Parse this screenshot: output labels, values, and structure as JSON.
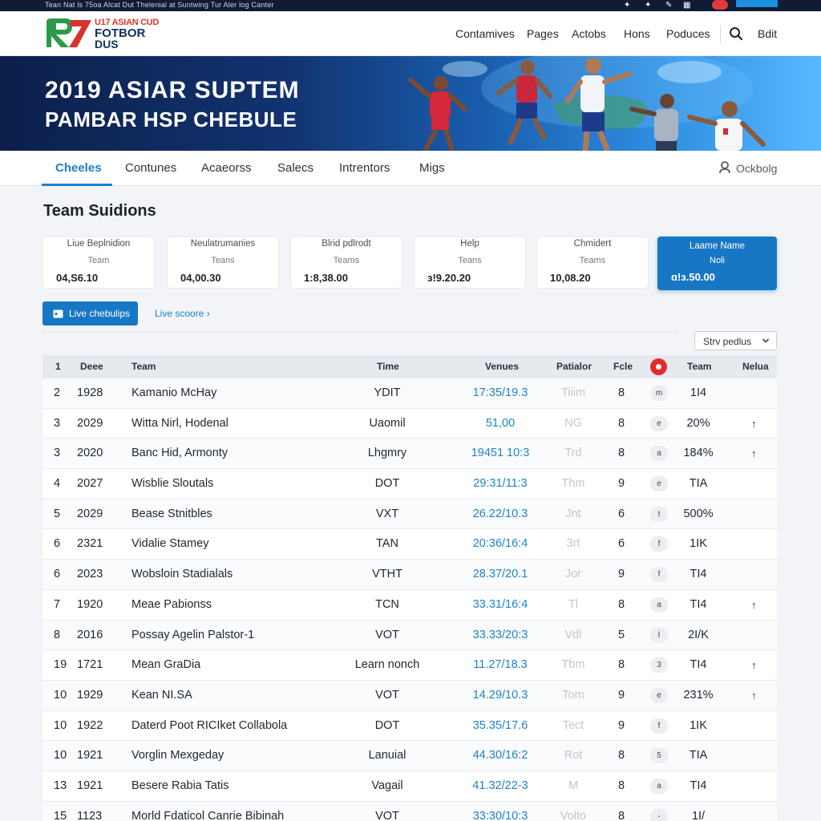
{
  "topstrip": {
    "text": "Tean Nat ls 75oa Alcat Dut Thelenial at Suntwing Tur Aler log Canter"
  },
  "header": {
    "logo": {
      "line1": "U17 ASIAN CUD",
      "line2": "FOTBOR",
      "line3": "DUS"
    },
    "nav": [
      "Contamives",
      "Pages",
      "Actobs",
      "Hons",
      "Poduces"
    ],
    "edit_label": "Bdit"
  },
  "banner": {
    "title": "2019 ASIAR SUPTEM",
    "subtitle": "PAMBAR HSP CHEBULE"
  },
  "tabs": [
    "Cheeles",
    "Contunes",
    "Acaeorss",
    "Salecs",
    "Intrentors",
    "Migs"
  ],
  "user_label": "Ockbolg",
  "section_title": "Team Suidions",
  "cards": [
    {
      "title": "Liue Beplnidion",
      "sub": "Team",
      "value": "04,S6.10"
    },
    {
      "title": "Neulatrumanies",
      "sub": "Teans",
      "value": "04,00.30"
    },
    {
      "title": "Blrid pdlrodt",
      "sub": "Teams",
      "value": "1:8,38.00"
    },
    {
      "title": "Help",
      "sub": "Teans",
      "value": "ɜ!9.20.20"
    },
    {
      "title": "Chmidert",
      "sub": "Teams",
      "value": "10,08.20"
    },
    {
      "title": "Laame Name",
      "sub": "Noli",
      "value": "ɑ!ɜ.50.00"
    }
  ],
  "live_button": "Live chebulips",
  "live_score": "Live scoore ›",
  "sort_select": "Strv pedlus",
  "table": {
    "headers": [
      "1",
      "Deee",
      "Team",
      "Time",
      "Venues",
      "Patialor",
      "Fcle",
      "Team",
      "Nelua"
    ],
    "rows": [
      {
        "n": "2",
        "year": "1928",
        "team": "Kamanio McHay",
        "time": "YDIT",
        "venue": "17:35/19.3",
        "pat": "Tiiim",
        "f": "8",
        "pill": "m",
        "t2": "1I4",
        "arrow": ""
      },
      {
        "n": "3",
        "year": "2029",
        "team": "Witta Nirl, Hodenal",
        "time": "Uaomil",
        "venue": "51,00",
        "pat": "NG",
        "f": "8",
        "pill": "e",
        "t2": "20%",
        "arrow": "↑"
      },
      {
        "n": "3",
        "year": "2020",
        "team": "Banc Hid, Armonty",
        "time": "Lhgmry",
        "venue": "19451 10:3",
        "pat": "Trd",
        "f": "8",
        "pill": "a",
        "t2": "184%",
        "arrow": "↑"
      },
      {
        "n": "4",
        "year": "2027",
        "team": "Wisblie Sloutals",
        "time": "DOT",
        "venue": "29:31/11:3",
        "pat": "Thm",
        "f": "9",
        "pill": "e",
        "t2": "TIA",
        "arrow": ""
      },
      {
        "n": "5",
        "year": "2029",
        "team": "Bease Stnitbles",
        "time": "VXT",
        "venue": "26.22/10.3",
        "pat": "Jnt",
        "f": "6",
        "pill": "t",
        "t2": "500%",
        "arrow": ""
      },
      {
        "n": "6",
        "year": "2321",
        "team": "Vidalie Stamey",
        "time": "TAN",
        "venue": "20:36/16:4",
        "pat": "3rt",
        "f": "6",
        "pill": "f",
        "t2": "1IK",
        "arrow": ""
      },
      {
        "n": "6",
        "year": "2023",
        "team": "Wobsloin Stadialals",
        "time": "VTHT",
        "venue": "28.37/20.1",
        "pat": "Jor",
        "f": "9",
        "pill": "f",
        "t2": "TI4",
        "arrow": ""
      },
      {
        "n": "7",
        "year": "1920",
        "team": "Meae Pabionss",
        "time": "TCN",
        "venue": "33.31/16:4",
        "pat": "Tl",
        "f": "8",
        "pill": "a",
        "t2": "TI4",
        "arrow": "↑"
      },
      {
        "n": "8",
        "year": "2016",
        "team": "Possay Agelin Palstor-1",
        "time": "VOT",
        "venue": "33.33/20:3",
        "pat": "Vdl",
        "f": "5",
        "pill": "l",
        "t2": "2I/K",
        "arrow": ""
      },
      {
        "n": "19",
        "year": "1721",
        "team": "Mean GraDia",
        "time": "Learn nonch",
        "venue": "11.27/18.3",
        "pat": "Tbm",
        "f": "8",
        "pill": "3",
        "t2": "TI4",
        "arrow": "↑"
      },
      {
        "n": "10",
        "year": "1929",
        "team": "Kean NI.SA",
        "time": "VOT",
        "venue": "14.29/10.3",
        "pat": "Tom",
        "f": "9",
        "pill": "e",
        "t2": "231%",
        "arrow": "↑"
      },
      {
        "n": "10",
        "year": "1922",
        "team": "Daterd Poot RICIket Collabola",
        "time": "DOT",
        "venue": "35.35/17.6",
        "pat": "Tect",
        "f": "9",
        "pill": "f",
        "t2": "1IK",
        "arrow": ""
      },
      {
        "n": "10",
        "year": "1921",
        "team": "Vorglin Mexgeday",
        "time": "Lanuial",
        "venue": "44.30/16:2",
        "pat": "Rot",
        "f": "8",
        "pill": "5",
        "t2": "TIA",
        "arrow": ""
      },
      {
        "n": "13",
        "year": "1921",
        "team": "Besere Rabia Tatis",
        "time": "Vagail",
        "venue": "41.32/22-3",
        "pat": "M",
        "f": "8",
        "pill": "a",
        "t2": "TI4",
        "arrow": ""
      },
      {
        "n": "15",
        "year": "1123",
        "team": "Morld Fdaticol Canrie Bibinah",
        "time": "VOT",
        "venue": "33:30/10:3",
        "pat": "Volto",
        "f": "8",
        "pill": "-",
        "t2": "1I/",
        "arrow": ""
      }
    ]
  }
}
